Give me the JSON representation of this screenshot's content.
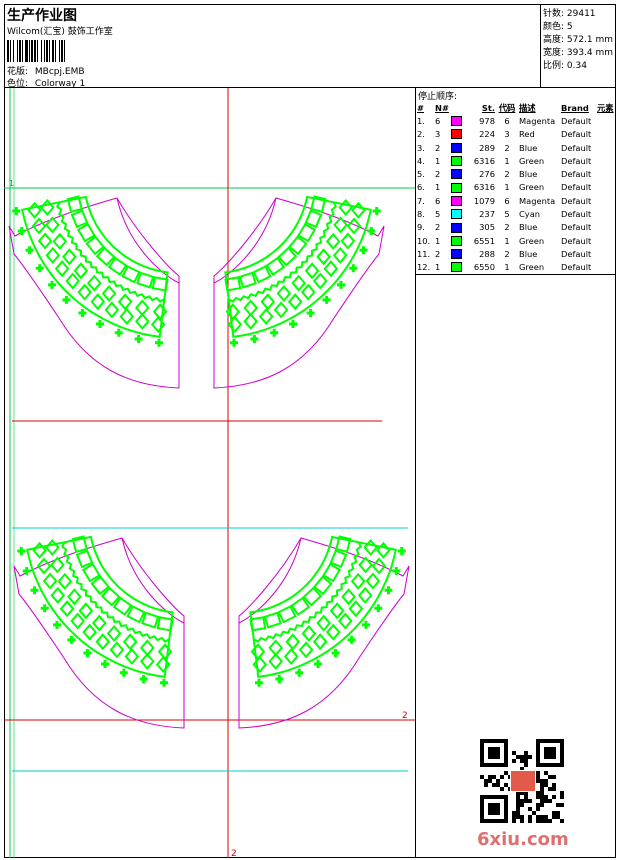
{
  "header": {
    "title": "生产作业图",
    "company": "Wilcom(汇宝) 鼓饰工作室",
    "design_label": "花版:",
    "design_value": "MBcpj.EMB",
    "colorway_label": "色位:",
    "colorway_value": "Colorway 1"
  },
  "stats": {
    "stitches": "针数: 29411",
    "colors": "颜色: 5",
    "height": "高度: 572.1 mm",
    "width": "宽度: 393.4 mm",
    "scale": "比例: 0.34"
  },
  "stop_sequence": {
    "title": "停止顺序:",
    "headers": [
      "#",
      "N#",
      "",
      "St.",
      "代码",
      "描述",
      "Brand",
      "元素"
    ],
    "rows": [
      {
        "idx": "1.",
        "n": "6",
        "color": "#ff00ff",
        "st": "978",
        "code": "6",
        "desc": "Magenta",
        "brand": "Default"
      },
      {
        "idx": "2.",
        "n": "3",
        "color": "#ff0000",
        "st": "224",
        "code": "3",
        "desc": "Red",
        "brand": "Default"
      },
      {
        "idx": "3.",
        "n": "2",
        "color": "#0000ff",
        "st": "289",
        "code": "2",
        "desc": "Blue",
        "brand": "Default"
      },
      {
        "idx": "4.",
        "n": "1",
        "color": "#00ff00",
        "st": "6316",
        "code": "1",
        "desc": "Green",
        "brand": "Default"
      },
      {
        "idx": "5.",
        "n": "2",
        "color": "#0000ff",
        "st": "276",
        "code": "2",
        "desc": "Blue",
        "brand": "Default"
      },
      {
        "idx": "6.",
        "n": "1",
        "color": "#00ff00",
        "st": "6316",
        "code": "1",
        "desc": "Green",
        "brand": "Default"
      },
      {
        "idx": "7.",
        "n": "6",
        "color": "#ff00ff",
        "st": "1079",
        "code": "6",
        "desc": "Magenta",
        "brand": "Default"
      },
      {
        "idx": "8.",
        "n": "5",
        "color": "#00ffff",
        "st": "237",
        "code": "5",
        "desc": "Cyan",
        "brand": "Default"
      },
      {
        "idx": "9.",
        "n": "2",
        "color": "#0000ff",
        "st": "305",
        "code": "2",
        "desc": "Blue",
        "brand": "Default"
      },
      {
        "idx": "10.",
        "n": "1",
        "color": "#00ff00",
        "st": "6551",
        "code": "1",
        "desc": "Green",
        "brand": "Default"
      },
      {
        "idx": "11.",
        "n": "2",
        "color": "#0000ff",
        "st": "288",
        "code": "2",
        "desc": "Blue",
        "brand": "Default"
      },
      {
        "idx": "12.",
        "n": "1",
        "color": "#00ff00",
        "st": "6550",
        "code": "1",
        "desc": "Green",
        "brand": "Default"
      }
    ]
  },
  "design": {
    "markers": {
      "top_left": "1",
      "bottom_right": "2",
      "bottom_center": "2"
    },
    "colors": {
      "outline": "#cc00cc",
      "fill": "#00ff00",
      "guide_green": "#00cc44",
      "guide_red": "#dd0000",
      "guide_cyan": "#00cccc"
    }
  },
  "watermark": "6xiu.com"
}
